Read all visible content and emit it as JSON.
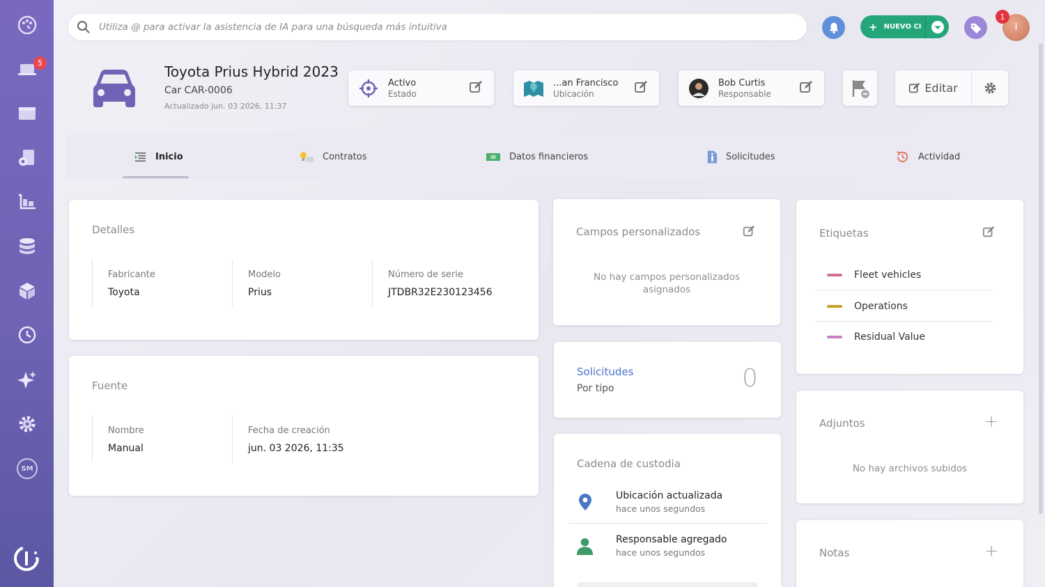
{
  "sidebar": {
    "items": [
      {
        "name": "dashboard-icon"
      },
      {
        "name": "laptop-icon",
        "badge": "5"
      },
      {
        "name": "browser-window-icon"
      },
      {
        "name": "devices-icon"
      },
      {
        "name": "inventory-cart-icon"
      },
      {
        "name": "database-icon"
      },
      {
        "name": "boxes-icon"
      },
      {
        "name": "history-icon"
      },
      {
        "name": "sparkle-icon"
      },
      {
        "name": "settings-gear-icon"
      }
    ],
    "sm_label": "SM"
  },
  "header": {
    "search_placeholder": "Utiliza @ para activar la asistencia de IA para una búsqueda más intuitiva",
    "nuevo_label": "NUEVO CI",
    "avatar_initial": "I",
    "notification_count": "1"
  },
  "asset": {
    "title": "Toyota Prius Hybrid 2023",
    "code": "Car CAR-0006",
    "updated": "Actualizado jun. 03 2026, 11:37"
  },
  "chips": {
    "status": {
      "value": "Activo",
      "label": "Estado"
    },
    "location": {
      "value": "...an Francisco",
      "label": "Ubicación"
    },
    "owner": {
      "value": "Bob Curtis",
      "label": "Responsable"
    }
  },
  "actions": {
    "edit_label": "Editar"
  },
  "tabs": [
    {
      "label": "Inicio"
    },
    {
      "label": "Contratos"
    },
    {
      "label": "Datos financieros"
    },
    {
      "label": "Solicitudes"
    },
    {
      "label": "Actividad"
    }
  ],
  "details": {
    "heading": "Detalles",
    "fields": [
      {
        "label": "Fabricante",
        "value": "Toyota"
      },
      {
        "label": "Modelo",
        "value": "Prius"
      },
      {
        "label": "Número de serie",
        "value": "JTDBR32E230123456"
      }
    ]
  },
  "source": {
    "heading": "Fuente",
    "fields": [
      {
        "label": "Nombre",
        "value": "Manual"
      },
      {
        "label": "Fecha de creación",
        "value": "jun. 03 2026, 11:35"
      }
    ]
  },
  "custom_fields": {
    "heading": "Campos personalizados",
    "empty": "No hay campos personalizados asignados"
  },
  "requests": {
    "title": "Solicitudes",
    "subtitle": "Por tipo",
    "count": "0"
  },
  "custody": {
    "heading": "Cadena de custodia",
    "events": [
      {
        "title": "Ubicación actualizada",
        "time": "hace unos segundos"
      },
      {
        "title": "Responsable agregado",
        "time": "hace unos segundos"
      }
    ]
  },
  "tags": {
    "heading": "Etiquetas",
    "items": [
      {
        "label": "Fleet vehicles",
        "color": "#d0709a"
      },
      {
        "label": "Operations",
        "color": "#c9a02a"
      },
      {
        "label": "Residual Value",
        "color": "#c67fc4"
      }
    ]
  },
  "attachments": {
    "heading": "Adjuntos",
    "empty": "No hay archivos subidos"
  },
  "notes": {
    "heading": "Notas"
  }
}
